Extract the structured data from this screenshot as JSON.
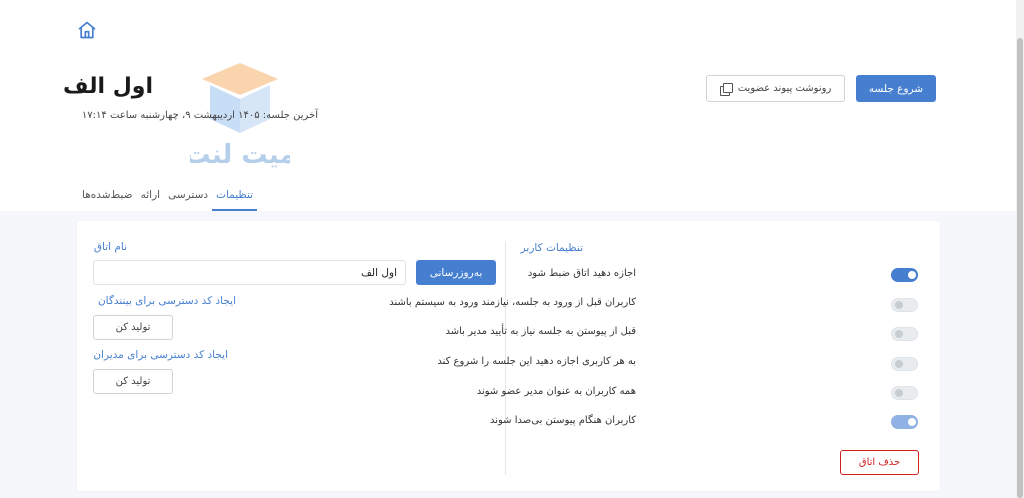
{
  "header": {
    "room_title": "اول الف",
    "last_session": "آخرین جلسه: ۱۴۰۵ اردیبهشت ۹، چهارشنبه ساعت ۱۷:۱۴",
    "start_button": "شروع جلسه",
    "copy_button": "رونوشت پیوند عضویت"
  },
  "logo": {
    "text": "میت‌ لنت"
  },
  "tabs": [
    {
      "label": "ضبط‌شده‌ها",
      "active": false
    },
    {
      "label": "ارائه",
      "active": false
    },
    {
      "label": "دسترسی",
      "active": false
    },
    {
      "label": "تنظیمات",
      "active": true
    }
  ],
  "user_settings": {
    "title": "تنظیمات کاربر",
    "items": [
      {
        "label": "اجازه دهید اتاق ضبط شود",
        "state": "on"
      },
      {
        "label": "کاربران قبل از ورود به جلسه، نیازمند ورود به سیستم باشند",
        "state": "off"
      },
      {
        "label": "قبل از پیوستن به جلسه نیاز به تأیید مدیر باشد",
        "state": "off"
      },
      {
        "label": "به هر کاربری اجازه دهید این جلسه را شروع کند",
        "state": "off"
      },
      {
        "label": "همه کاربران به عنوان مدیر عضو شوند",
        "state": "off"
      },
      {
        "label": "کاربران هنگام پیوستن بی‌صدا شوند",
        "state": "light"
      }
    ],
    "delete_button": "حذف اتاق"
  },
  "room_settings": {
    "name_label": "نام اتاق",
    "name_value": "اول الف",
    "update_button": "به‌روزرسانی",
    "viewer_code_label": "ایجاد کد دسترسی برای بینندگان",
    "viewer_generate": "تولید کن",
    "moderator_code_label": "ایجاد کد دسترسی برای مدیران",
    "moderator_generate": "تولید کن"
  },
  "colors": {
    "accent": "#467fcf",
    "danger": "#cd201f",
    "page_bg": "#f5f7fb"
  }
}
